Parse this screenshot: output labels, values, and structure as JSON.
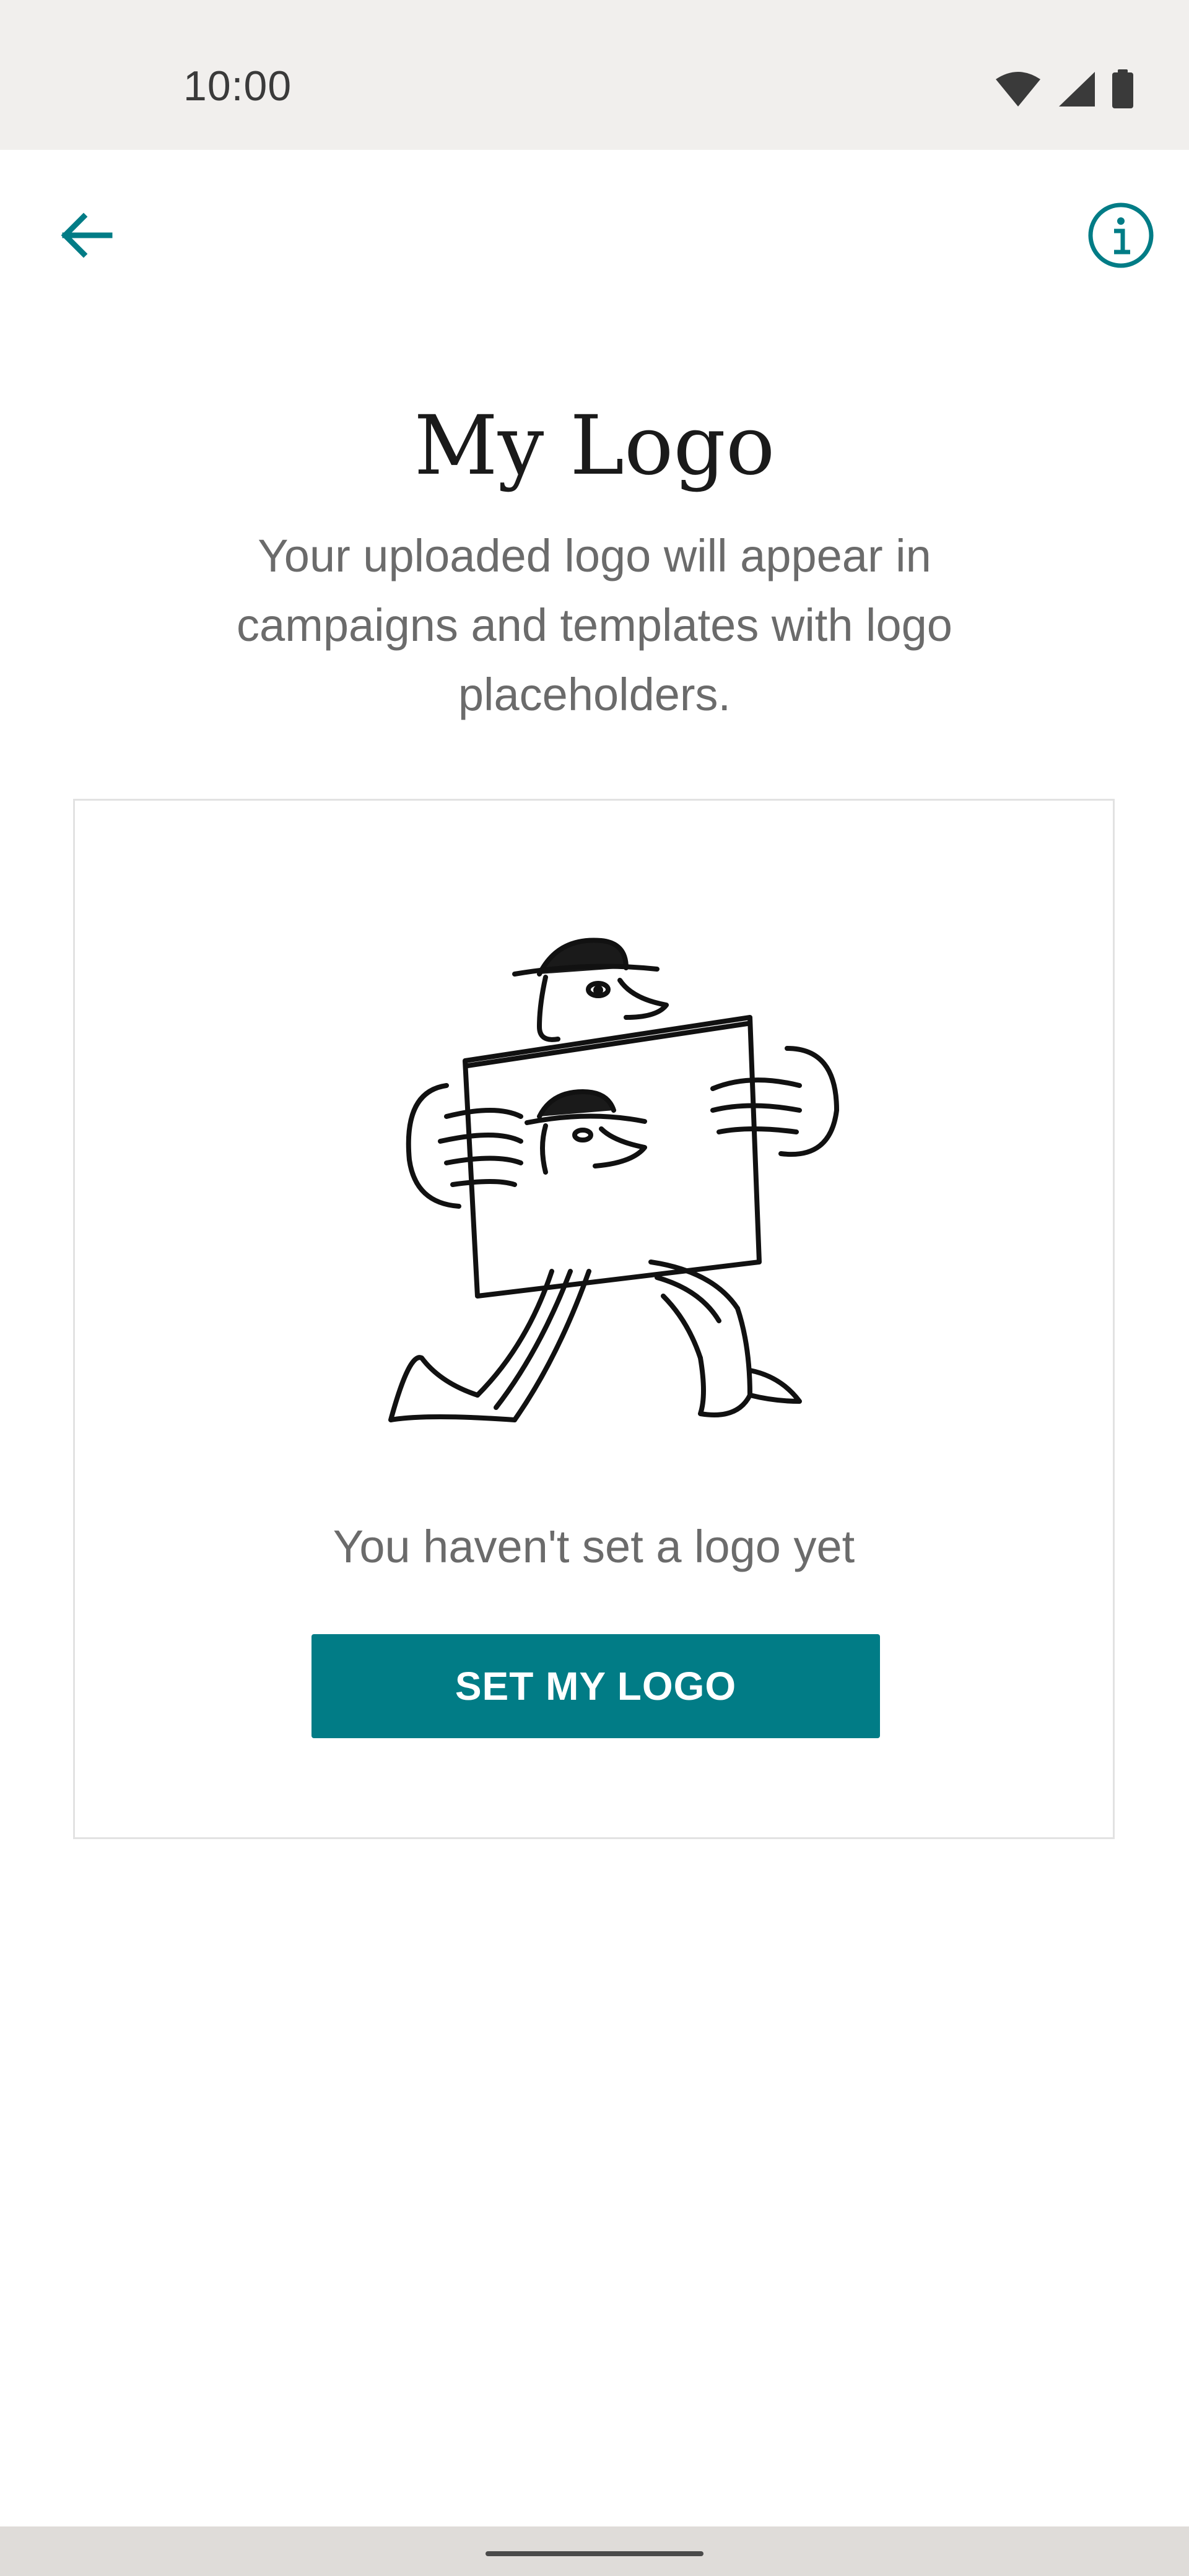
{
  "status_bar": {
    "time": "10:00",
    "icons": [
      "wifi-icon",
      "cellular-signal-icon",
      "battery-icon"
    ]
  },
  "header": {
    "back_icon": "arrow-left-icon",
    "info_icon": "info-circle-icon"
  },
  "page": {
    "title": "My Logo",
    "description": "Your uploaded logo will appear in campaigns and templates with logo placeholders."
  },
  "empty_state": {
    "message": "You haven't set a logo yet",
    "button_label": "SET MY LOGO"
  },
  "colors": {
    "accent": "#017c86",
    "status_bar_bg": "#f1efed",
    "nav_bar_bg": "#dfdcd9",
    "text_primary": "#1a1a1a",
    "text_secondary": "#6b6b6b"
  }
}
